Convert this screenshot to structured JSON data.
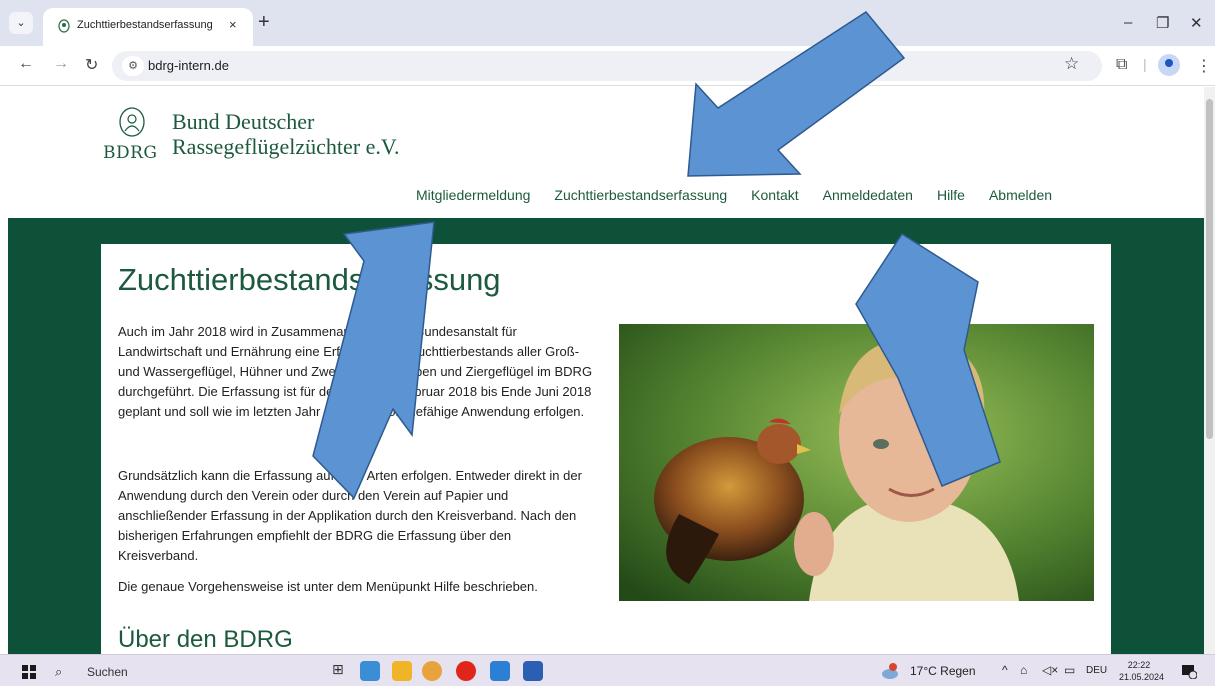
{
  "browser": {
    "tab_title": "Zuchttierbestandserfassung der",
    "tab_close": "×",
    "new_tab": "+",
    "url": "bdrg-intern.de",
    "window_controls": [
      "–",
      "❐",
      "✕"
    ]
  },
  "site": {
    "logo_abbr": "BDRG",
    "logo_line1": "Bund Deutscher",
    "logo_line2": "Rassegeflügelzüchter e.V.",
    "nav": [
      "Mitgliedermeldung",
      "Zuchttierbestandserfassung",
      "Kontakt",
      "Anmeldedaten",
      "Hilfe",
      "Abmelden"
    ]
  },
  "main": {
    "title": "Zuchttierbestandserfassung",
    "paragraph1": "Auch im Jahr 2018 wird in Zusammenarbeit mit der Bundesanstalt für Landwirtschaft und Ernährung eine Erfassung des Zuchttierbestands aller Groß- und Wassergeflügel, Hühner und Zwerghühner, Tauben und Ziergeflügel im BDRG durchgeführt. Die Erfassung ist für den Zeitraum Februar 2018 bis Ende Juni 2018 geplant und soll wie im letzten Jahr über diese onlinefähige Anwendung erfolgen.",
    "paragraph2": "Grundsätzlich kann die Erfassung auf zwei Arten erfolgen. Entweder direkt in der Anwendung durch den Verein oder durch den Verein auf Papier und anschließender Erfassung in der Applikation durch den Kreisverband. Nach den bisherigen Erfahrungen empfiehlt der BDRG die Erfassung über den Kreisverband.",
    "paragraph3": "Die genaue Vorgehensweise ist unter dem Menüpunkt Hilfe beschrieben.",
    "subtitle": "Über den BDRG"
  },
  "taskbar": {
    "search_label": "Suchen",
    "weather": "17°C Regen",
    "language": "DEU",
    "time": "22:22",
    "date": "21.05.2024",
    "notification_count": "2"
  },
  "colors": {
    "brand_green": "#1d5a3d",
    "band_green": "#0d5138",
    "arrow_fill": "#5b93d3",
    "arrow_stroke": "#2e5a8e"
  }
}
